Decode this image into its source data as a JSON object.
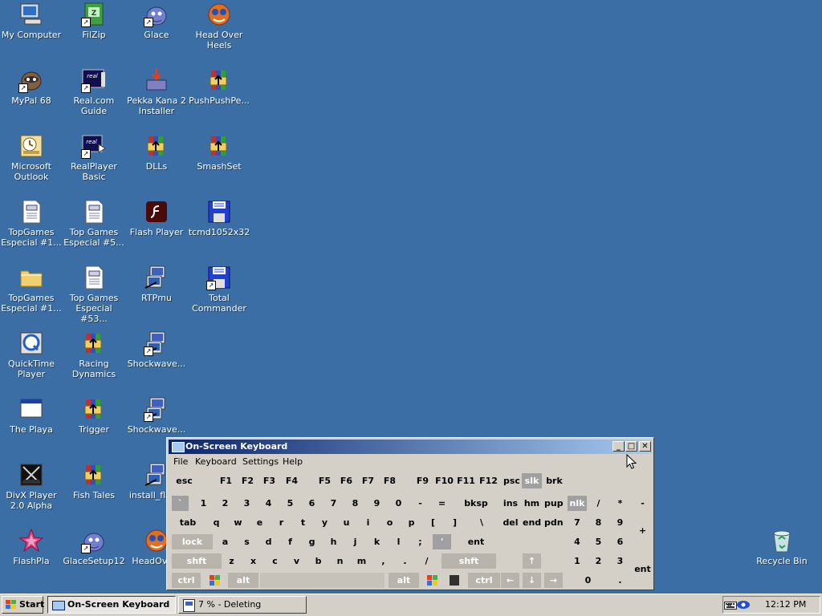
{
  "desktop": {
    "icons": [
      {
        "label": "My Computer",
        "icon": "my-computer-icon"
      },
      {
        "label": "FilZip",
        "icon": "filzip-icon"
      },
      {
        "label": "Glace",
        "icon": "glace-icon"
      },
      {
        "label": "Head Over Heels",
        "icon": "head-over-heels-icon"
      },
      {
        "label": "MyPal 68",
        "icon": "mypal-icon"
      },
      {
        "label": "Real.com Guide",
        "icon": "real-guide-icon"
      },
      {
        "label": "Pekka Kana 2 Installer",
        "icon": "installer-icon"
      },
      {
        "label": "PushPushPe...",
        "icon": "winrar-archive-icon"
      },
      {
        "label": "Microsoft Outlook",
        "icon": "outlook-icon"
      },
      {
        "label": "RealPlayer Basic",
        "icon": "realplayer-icon"
      },
      {
        "label": "DLLs",
        "icon": "winrar-archive-icon"
      },
      {
        "label": "SmashSet",
        "icon": "winrar-archive-icon"
      },
      {
        "label": "TopGames Especial #1...",
        "icon": "document-icon"
      },
      {
        "label": "Top Games Especial #5...",
        "icon": "document-icon"
      },
      {
        "label": "Flash Player",
        "icon": "flash-player-icon"
      },
      {
        "label": "tcmd1052x32",
        "icon": "floppy-setup-icon"
      },
      {
        "label": "TopGames Especial #1...",
        "icon": "folder-icon"
      },
      {
        "label": "Top Games Especial #53...",
        "icon": "document-icon"
      },
      {
        "label": "RTPmu",
        "icon": "setup-icon"
      },
      {
        "label": "Total Commander",
        "icon": "floppy-setup-icon"
      },
      {
        "label": "QuickTime Player",
        "icon": "quicktime-icon"
      },
      {
        "label": "Racing Dynamics",
        "icon": "winrar-archive-icon"
      },
      {
        "label": "Shockwave...",
        "icon": "setup-icon"
      },
      {
        "label": "The Playa",
        "icon": "application-window-icon"
      },
      {
        "label": "Trigger",
        "icon": "winrar-archive-icon"
      },
      {
        "label": "Shockwave...",
        "icon": "setup-icon"
      },
      {
        "label": "DivX Player 2.0 Alpha",
        "icon": "divx-icon"
      },
      {
        "label": "Fish Tales",
        "icon": "winrar-archive-icon"
      },
      {
        "label": "install_flas...",
        "icon": "setup-icon"
      },
      {
        "label": "FlashPla",
        "icon": "flash-star-icon"
      },
      {
        "label": "GlaceSetup12",
        "icon": "glace-icon"
      },
      {
        "label": "HeadOve...",
        "icon": "head-over-heels-icon"
      },
      {
        "label": "Recycle Bin",
        "icon": "recycle-bin-icon"
      }
    ]
  },
  "osk": {
    "title": "On-Screen Keyboard",
    "controls": {
      "minimize": "_",
      "maximize": "□",
      "close": "✕"
    },
    "menu": [
      "File",
      "Keyboard",
      "Settings",
      "Help"
    ],
    "row_fn": [
      "esc",
      "F1",
      "F2",
      "F3",
      "F4",
      "F5",
      "F6",
      "F7",
      "F8",
      "F9",
      "F10",
      "F11",
      "F12",
      "psc",
      "slk",
      "brk"
    ],
    "row_num": [
      "`",
      "1",
      "2",
      "3",
      "4",
      "5",
      "6",
      "7",
      "8",
      "9",
      "0",
      "-",
      "=",
      "bksp",
      "ins",
      "hm",
      "pup",
      "nlk",
      "/",
      "*",
      "-"
    ],
    "row_q": [
      "tab",
      "q",
      "w",
      "e",
      "r",
      "t",
      "y",
      "u",
      "i",
      "o",
      "p",
      "[",
      "]",
      "\\",
      "del",
      "end",
      "pdn",
      "7",
      "8",
      "9",
      "+"
    ],
    "row_a": [
      "lock",
      "a",
      "s",
      "d",
      "f",
      "g",
      "h",
      "j",
      "k",
      "l",
      ";",
      "'",
      "ent",
      "4",
      "5",
      "6"
    ],
    "row_z": [
      "shft",
      "z",
      "x",
      "c",
      "v",
      "b",
      "n",
      "m",
      ",",
      ".",
      "/",
      "shft",
      "↑",
      "1",
      "2",
      "3",
      "ent"
    ],
    "row_ctrl": [
      "ctrl",
      "win",
      "alt",
      "",
      "alt",
      "win",
      "menu",
      "ctrl",
      "←",
      "↓",
      "→",
      "0",
      "."
    ]
  },
  "taskbar": {
    "start": "Start",
    "tasks": [
      {
        "label": "On-Screen Keyboard",
        "active": true
      },
      {
        "label": "7 % - Deleting",
        "active": false
      }
    ],
    "tray": {
      "time": "12:12 PM",
      "expand": "«"
    }
  }
}
